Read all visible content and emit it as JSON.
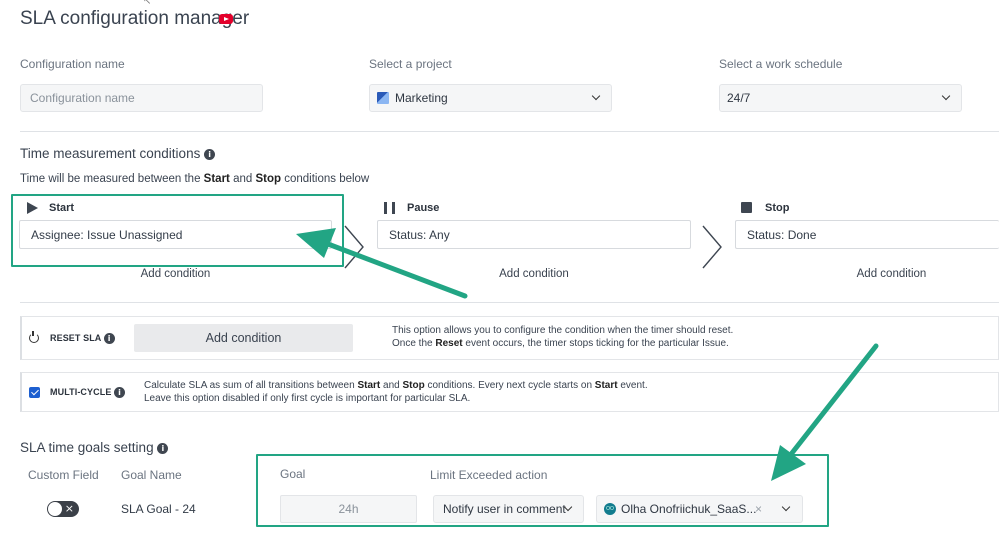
{
  "header": {
    "title": "SLA configuration manager",
    "title_icon": "youtube-icon"
  },
  "config": {
    "name_label": "Configuration name",
    "name_placeholder": "Configuration name",
    "project_label": "Select a project",
    "project_value": "Marketing",
    "schedule_label": "Select a work schedule",
    "schedule_value": "24/7"
  },
  "time_conditions": {
    "title": "Time measurement conditions",
    "desc_prefix": "Time will be measured between the ",
    "desc_start": "Start",
    "desc_and": " and ",
    "desc_stop": "Stop",
    "desc_suffix": " conditions below",
    "start": {
      "label": "Start",
      "value": "Assignee: Issue Unassigned",
      "add": "Add condition"
    },
    "pause": {
      "label": "Pause",
      "value": "Status: Any",
      "add": "Add condition"
    },
    "stop": {
      "label": "Stop",
      "value": "Status: Done",
      "add": "Add condition"
    }
  },
  "reset": {
    "label": "RESET SLA",
    "button": "Add condition",
    "line1": "This option allows you to configure the condition when the timer should reset.",
    "line2_prefix": "Once the ",
    "line2_bold": "Reset",
    "line2_suffix": " event occurs, the timer stops ticking for the particular Issue."
  },
  "multicycle": {
    "label": "MULTI-CYCLE",
    "checked": true,
    "line1_a": "Calculate SLA as sum of all transitions between ",
    "line1_b": "Start",
    "line1_c": " and ",
    "line1_d": "Stop",
    "line1_e": " conditions. Every next cycle starts on ",
    "line1_f": "Start",
    "line1_g": " event.",
    "line2": "Leave this option disabled if only first cycle is important for particular SLA."
  },
  "goals": {
    "title": "SLA time goals setting",
    "custom_field_header": "Custom Field",
    "goal_name_header": "Goal Name",
    "goal_header": "Goal",
    "limit_header": "Limit Exceeded action",
    "row": {
      "custom_field_enabled": false,
      "goal_name": "SLA Goal - 24",
      "goal": "24h",
      "action": "Notify user in comment",
      "user": "Olha Onofriichuk_SaaS...",
      "user_clear": "×",
      "user_avatar_initials": "OO"
    }
  },
  "annotation": {
    "color": "#22a584"
  }
}
